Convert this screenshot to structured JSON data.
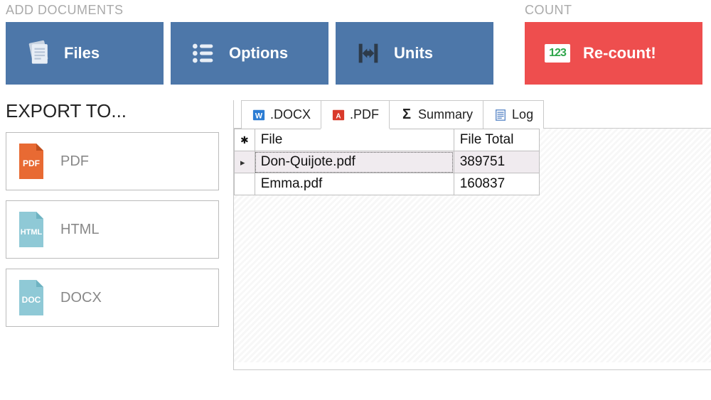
{
  "headings": {
    "add_documents": "ADD DOCUMENTS",
    "count": "COUNT",
    "export_to": "EXPORT TO..."
  },
  "ribbon": {
    "files": "Files",
    "options": "Options",
    "units": "Units",
    "recount": "Re-count!"
  },
  "export": {
    "pdf": "PDF",
    "html": "HTML",
    "docx": "DOCX"
  },
  "tabs": {
    "docx": ".DOCX",
    "pdf": ".PDF",
    "summary": "Summary",
    "log": "Log"
  },
  "table": {
    "col_file": "File",
    "col_total": "File Total",
    "rows": [
      {
        "file": "Don-Quijote.pdf",
        "total": "389751",
        "selected": true
      },
      {
        "file": "Emma.pdf",
        "total": "160837",
        "selected": false
      }
    ]
  }
}
